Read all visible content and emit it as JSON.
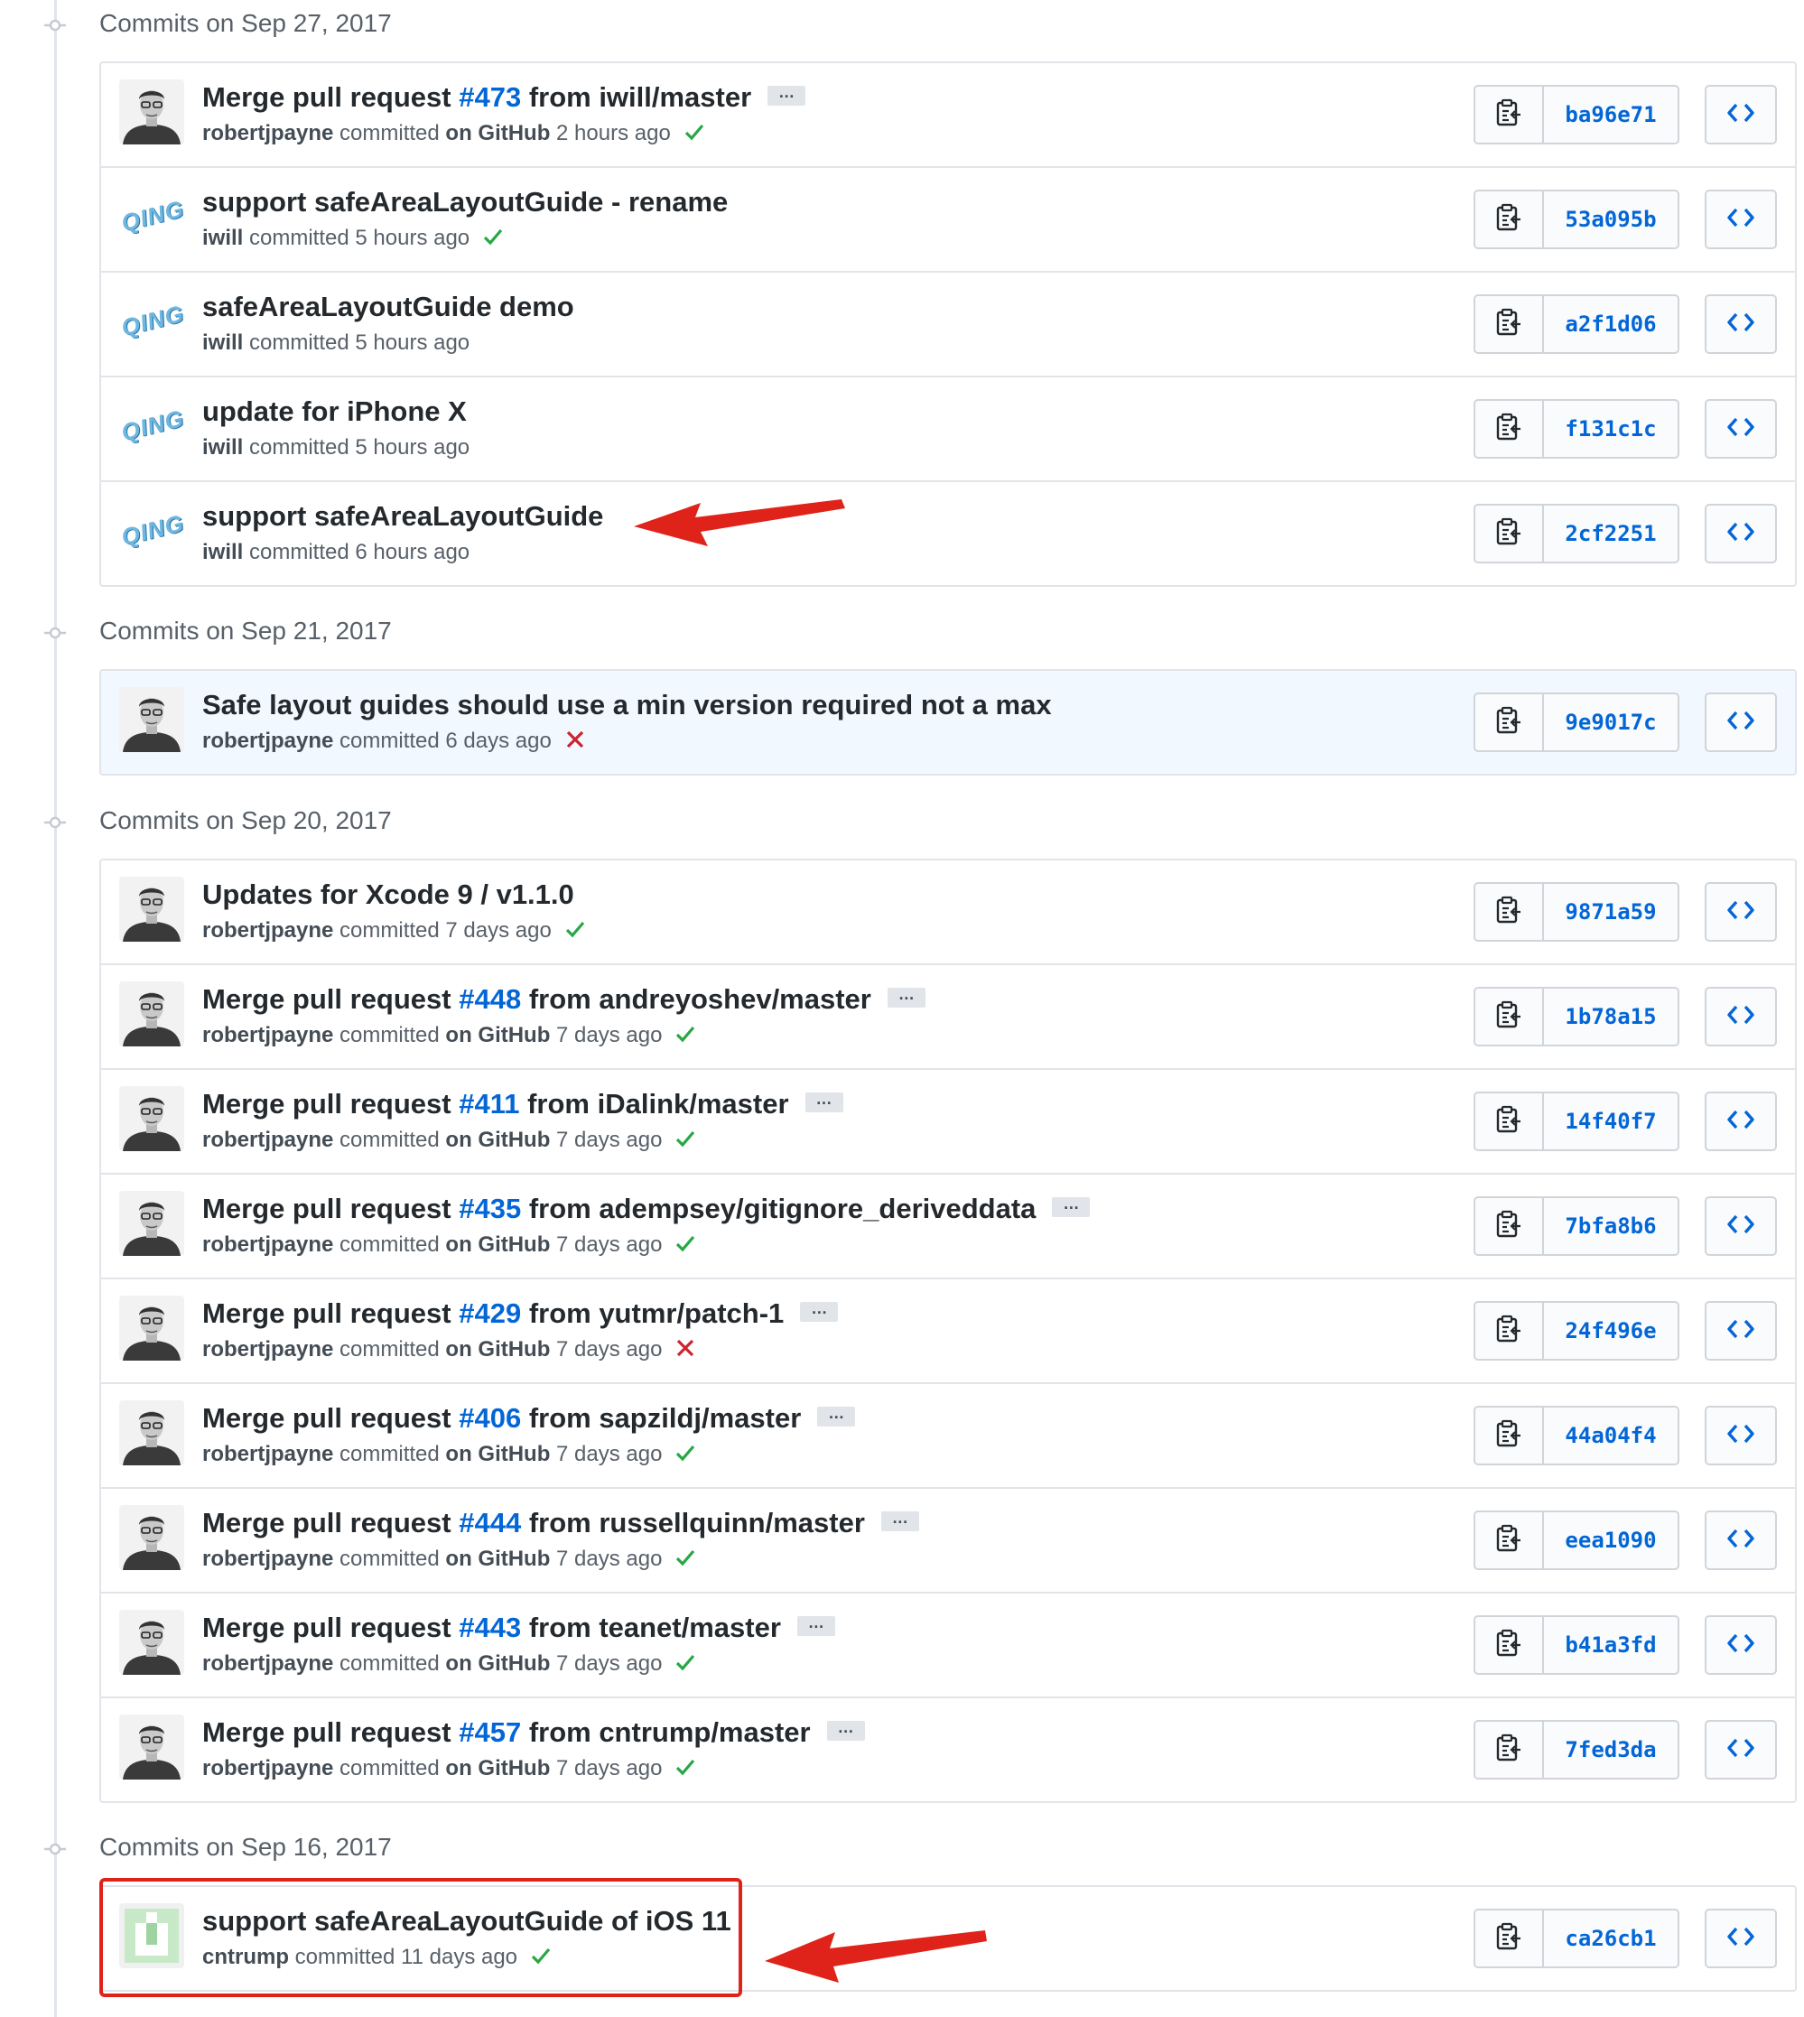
{
  "groups": [
    {
      "title": "Commits on Sep 27, 2017",
      "commits": [
        {
          "msg_prefix": "Merge pull request ",
          "pr": "#473",
          "msg_suffix": " from iwill/master",
          "author": "robertjpayne",
          "committed": " committed ",
          "on_github": "on GitHub",
          "time": " 2 hours ago",
          "status": "success",
          "sha": "ba96e71",
          "avatar": "robertjpayne"
        },
        {
          "msg_prefix": "support safeAreaLayoutGuide - rename",
          "pr": "",
          "msg_suffix": "",
          "author": "iwill",
          "committed": " committed",
          "on_github": "",
          "time": " 5 hours ago",
          "status": "success",
          "sha": "53a095b",
          "avatar": "qing"
        },
        {
          "msg_prefix": "safeAreaLayoutGuide demo",
          "pr": "",
          "msg_suffix": "",
          "author": "iwill",
          "committed": " committed",
          "on_github": "",
          "time": " 5 hours ago",
          "status": "none",
          "sha": "a2f1d06",
          "avatar": "qing"
        },
        {
          "msg_prefix": "update for iPhone X",
          "pr": "",
          "msg_suffix": "",
          "author": "iwill",
          "committed": " committed",
          "on_github": "",
          "time": " 5 hours ago",
          "status": "none",
          "sha": "f131c1c",
          "avatar": "qing"
        },
        {
          "msg_prefix": "support safeAreaLayoutGuide",
          "pr": "",
          "msg_suffix": "",
          "author": "iwill",
          "committed": " committed",
          "on_github": "",
          "time": " 6 hours ago",
          "status": "none",
          "sha": "2cf2251",
          "avatar": "qing"
        }
      ]
    },
    {
      "title": "Commits on Sep 21, 2017",
      "commits": [
        {
          "msg_prefix": "Safe layout guides should use a min version required not a max",
          "pr": "",
          "msg_suffix": "",
          "author": "robertjpayne",
          "committed": " committed",
          "on_github": "",
          "time": " 6 days ago",
          "status": "failure",
          "sha": "9e9017c",
          "avatar": "robertjpayne",
          "highlight": true
        }
      ]
    },
    {
      "title": "Commits on Sep 20, 2017",
      "commits": [
        {
          "msg_prefix": "Updates for Xcode 9 / v1.1.0",
          "pr": "",
          "msg_suffix": "",
          "author": "robertjpayne",
          "committed": " committed",
          "on_github": "",
          "time": " 7 days ago",
          "status": "success",
          "sha": "9871a59",
          "avatar": "robertjpayne"
        },
        {
          "msg_prefix": "Merge pull request ",
          "pr": "#448",
          "msg_suffix": " from andreyoshev/master",
          "author": "robertjpayne",
          "committed": " committed ",
          "on_github": "on GitHub",
          "time": " 7 days ago",
          "status": "success",
          "sha": "1b78a15",
          "avatar": "robertjpayne"
        },
        {
          "msg_prefix": "Merge pull request ",
          "pr": "#411",
          "msg_suffix": " from iDalink/master",
          "author": "robertjpayne",
          "committed": " committed ",
          "on_github": "on GitHub",
          "time": " 7 days ago",
          "status": "success",
          "sha": "14f40f7",
          "avatar": "robertjpayne"
        },
        {
          "msg_prefix": "Merge pull request ",
          "pr": "#435",
          "msg_suffix": " from adempsey/gitignore_deriveddata",
          "author": "robertjpayne",
          "committed": " committed ",
          "on_github": "on GitHub",
          "time": " 7 days ago",
          "status": "success",
          "sha": "7bfa8b6",
          "avatar": "robertjpayne"
        },
        {
          "msg_prefix": "Merge pull request ",
          "pr": "#429",
          "msg_suffix": " from yutmr/patch-1",
          "author": "robertjpayne",
          "committed": " committed ",
          "on_github": "on GitHub",
          "time": " 7 days ago",
          "status": "failure",
          "sha": "24f496e",
          "avatar": "robertjpayne"
        },
        {
          "msg_prefix": "Merge pull request ",
          "pr": "#406",
          "msg_suffix": " from sapzildj/master",
          "author": "robertjpayne",
          "committed": " committed ",
          "on_github": "on GitHub",
          "time": " 7 days ago",
          "status": "success",
          "sha": "44a04f4",
          "avatar": "robertjpayne"
        },
        {
          "msg_prefix": "Merge pull request ",
          "pr": "#444",
          "msg_suffix": " from russellquinn/master",
          "author": "robertjpayne",
          "committed": " committed ",
          "on_github": "on GitHub",
          "time": " 7 days ago",
          "status": "success",
          "sha": "eea1090",
          "avatar": "robertjpayne"
        },
        {
          "msg_prefix": "Merge pull request ",
          "pr": "#443",
          "msg_suffix": " from teanet/master",
          "author": "robertjpayne",
          "committed": " committed ",
          "on_github": "on GitHub",
          "time": " 7 days ago",
          "status": "success",
          "sha": "b41a3fd",
          "avatar": "robertjpayne"
        },
        {
          "msg_prefix": "Merge pull request ",
          "pr": "#457",
          "msg_suffix": " from cntrump/master",
          "author": "robertjpayne",
          "committed": " committed ",
          "on_github": "on GitHub",
          "time": " 7 days ago",
          "status": "success",
          "sha": "7fed3da",
          "avatar": "robertjpayne"
        }
      ]
    },
    {
      "title": "Commits on Sep 16, 2017",
      "commits": [
        {
          "msg_prefix": "support safeAreaLayoutGuide of iOS 11",
          "pr": "",
          "msg_suffix": "",
          "author": "cntrump",
          "committed": " committed",
          "on_github": "",
          "time": " 11 days ago",
          "status": "success",
          "sha": "ca26cb1",
          "avatar": "identicon"
        }
      ]
    }
  ],
  "ellipsis_label": "…",
  "qing_logo_text": "QING",
  "colors": {
    "link": "#0366d6",
    "success": "#28a745",
    "failure": "#cb2431",
    "annotation": "#e0231a",
    "border": "#e1e4e8"
  },
  "icons": {
    "copy": "clippy-icon",
    "browse": "code-icon",
    "timeline": "git-commit-icon",
    "success": "check-icon",
    "failure": "x-icon"
  }
}
